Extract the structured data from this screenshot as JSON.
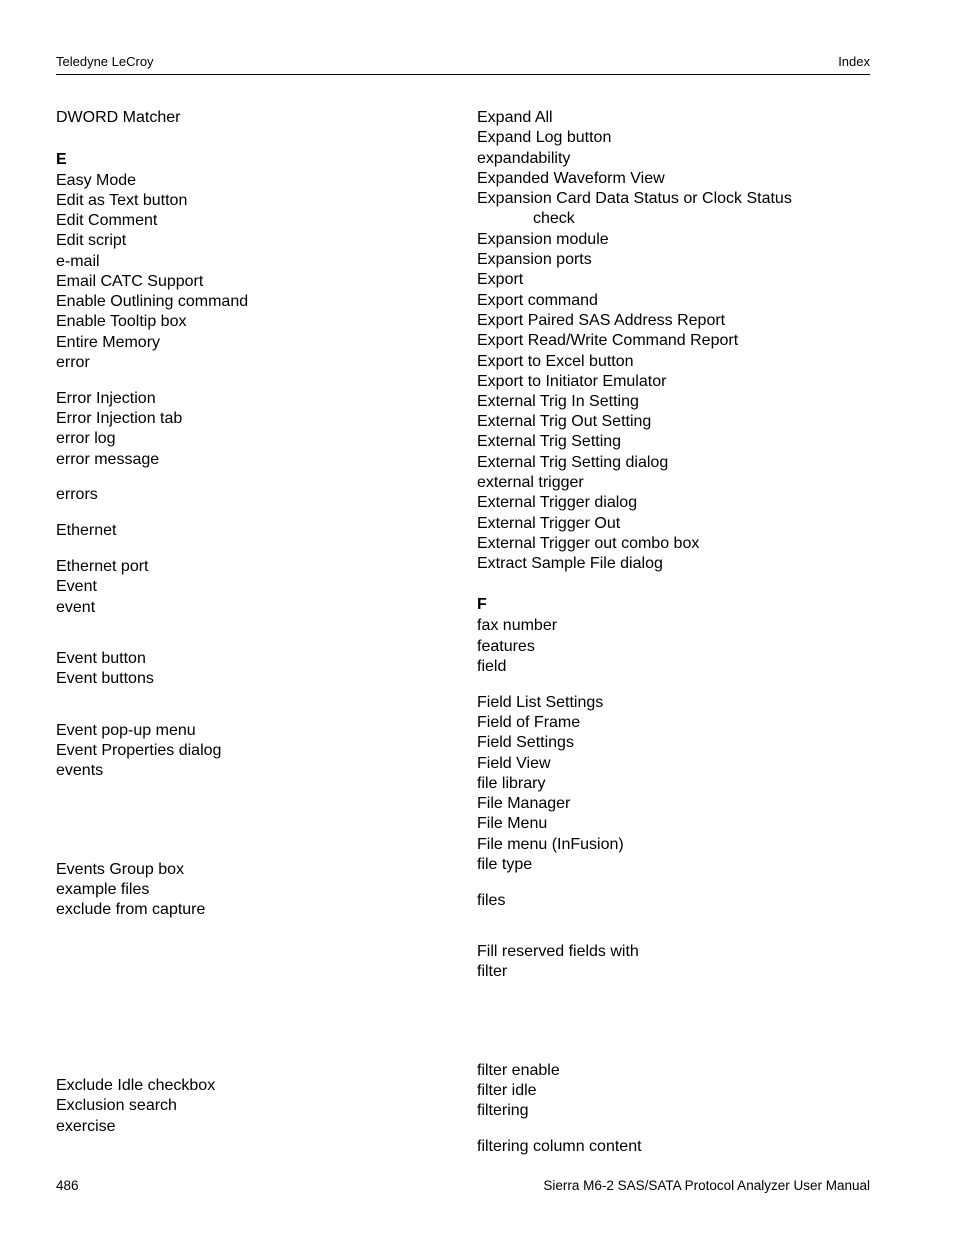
{
  "header": {
    "left": "Teledyne LeCroy",
    "right": "Index"
  },
  "footer": {
    "page_number": "486",
    "manual_title": "Sierra M6-2 SAS/SATA Protocol Analyzer User Manual"
  },
  "left_column": [
    {
      "text": "DWORD Matcher"
    },
    {
      "text": "E",
      "heading": true
    },
    {
      "text": "Easy Mode"
    },
    {
      "text": "Edit as Text button"
    },
    {
      "text": "Edit Comment"
    },
    {
      "text": "Edit script"
    },
    {
      "text": "e-mail"
    },
    {
      "text": "Email CATC Support"
    },
    {
      "text": "Enable Outlining command"
    },
    {
      "text": "Enable Tooltip box"
    },
    {
      "text": "Entire Memory"
    },
    {
      "text": "error"
    },
    {
      "text": "Error Injection"
    },
    {
      "text": "Error Injection tab"
    },
    {
      "text": "error log"
    },
    {
      "text": "error message"
    },
    {
      "text": "errors"
    },
    {
      "text": "Ethernet"
    },
    {
      "text": "Ethernet port"
    },
    {
      "text": "Event"
    },
    {
      "text": "event"
    },
    {
      "text": "Event button"
    },
    {
      "text": "Event buttons"
    },
    {
      "text": "Event pop-up menu"
    },
    {
      "text": "Event Properties dialog"
    },
    {
      "text": "events"
    },
    {
      "text": "Events Group box"
    },
    {
      "text": "example files"
    },
    {
      "text": "exclude from capture"
    },
    {
      "text": "Exclude Idle checkbox"
    },
    {
      "text": "Exclusion search"
    },
    {
      "text": "exercise"
    }
  ],
  "right_column": [
    {
      "text": "Expand All"
    },
    {
      "text": "Expand Log button"
    },
    {
      "text": "expandability"
    },
    {
      "text": "Expanded Waveform View"
    },
    {
      "text": "Expansion Card Data Status or Clock Status",
      "continuation": "check"
    },
    {
      "text": "Expansion module"
    },
    {
      "text": "Expansion ports"
    },
    {
      "text": "Export"
    },
    {
      "text": "Export command"
    },
    {
      "text": "Export Paired SAS Address Report"
    },
    {
      "text": "Export Read/Write Command Report"
    },
    {
      "text": "Export to Excel button"
    },
    {
      "text": "Export to Initiator Emulator"
    },
    {
      "text": "External Trig In Setting"
    },
    {
      "text": "External Trig Out Setting"
    },
    {
      "text": "External Trig Setting"
    },
    {
      "text": "External Trig Setting dialog"
    },
    {
      "text": "external trigger"
    },
    {
      "text": "External Trigger dialog"
    },
    {
      "text": "External Trigger Out"
    },
    {
      "text": "External Trigger out combo box"
    },
    {
      "text": "Extract Sample File dialog"
    },
    {
      "text": "F",
      "heading": true
    },
    {
      "text": "fax number"
    },
    {
      "text": "features"
    },
    {
      "text": "field"
    },
    {
      "text": "Field List Settings"
    },
    {
      "text": "Field of Frame"
    },
    {
      "text": "Field Settings"
    },
    {
      "text": "Field View"
    },
    {
      "text": "file library"
    },
    {
      "text": "File Manager"
    },
    {
      "text": "File Menu"
    },
    {
      "text": "File menu (InFusion)"
    },
    {
      "text": "file type"
    },
    {
      "text": "files"
    },
    {
      "text": "Fill reserved fields with"
    },
    {
      "text": "filter"
    },
    {
      "text": "filter enable"
    },
    {
      "text": "filter idle"
    },
    {
      "text": "filtering"
    },
    {
      "text": "filtering column content"
    }
  ]
}
